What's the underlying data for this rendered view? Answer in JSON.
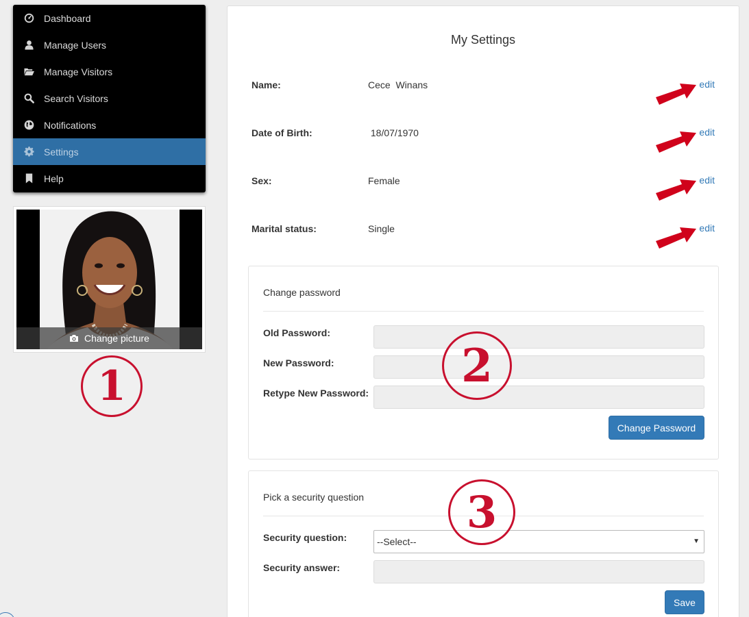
{
  "sidebar": {
    "items": [
      {
        "label": "Dashboard",
        "icon": "dashboard-icon",
        "active": false
      },
      {
        "label": "Manage Users",
        "icon": "user-icon",
        "active": false
      },
      {
        "label": "Manage Visitors",
        "icon": "folder-open-icon",
        "active": false
      },
      {
        "label": "Search Visitors",
        "icon": "search-icon",
        "active": false
      },
      {
        "label": "Notifications",
        "icon": "globe-icon",
        "active": false
      },
      {
        "label": "Settings",
        "icon": "gear-icon",
        "active": true
      },
      {
        "label": "Help",
        "icon": "bookmark-icon",
        "active": false
      }
    ]
  },
  "profile": {
    "change_picture_label": "Change picture"
  },
  "callouts": [
    "1",
    "2",
    "3"
  ],
  "settings": {
    "title": "My Settings",
    "fields": [
      {
        "label": "Name:",
        "value": "Cece  Winans",
        "edit": "edit"
      },
      {
        "label": "Date of Birth:",
        "value": " 18/07/1970",
        "edit": "edit"
      },
      {
        "label": "Sex:",
        "value": "Female",
        "edit": "edit"
      },
      {
        "label": "Marital status:",
        "value": "Single",
        "edit": "edit"
      }
    ]
  },
  "password_panel": {
    "title": "Change password",
    "old_label": "Old Password:",
    "new_label": "New Password:",
    "retype_label": "Retype New Password:",
    "button": "Change Password"
  },
  "security_panel": {
    "title": "Pick a security question",
    "question_label": "Security question:",
    "question_selected": "--Select--",
    "answer_label": "Security answer:",
    "button": "Save"
  },
  "colors": {
    "accent": "#337ab7",
    "sidebar_active": "#2f6fa5",
    "annotation_red": "#c8102e"
  }
}
